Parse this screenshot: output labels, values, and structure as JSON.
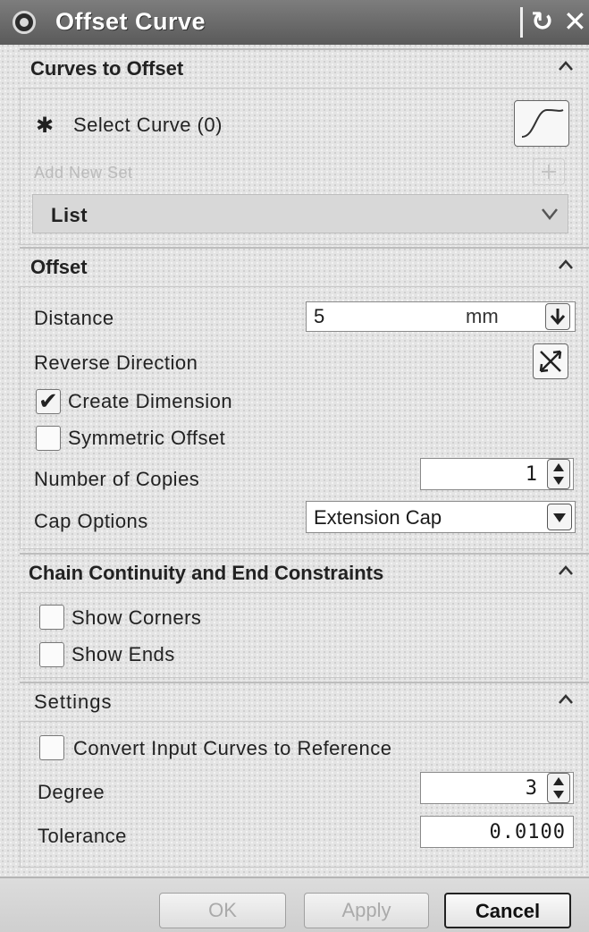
{
  "title_bar": {
    "title": "Offset Curve",
    "gear_icon": "gear-icon",
    "reset_icon": "reset-icon",
    "close_icon": "close-icon",
    "reset_glyph": "↻",
    "close_glyph": "✕"
  },
  "curves_to_offset": {
    "header": "Curves to Offset",
    "select_label": "Select Curve (0)",
    "select_icon": "asterisk-icon",
    "select_glyph": "✱",
    "curve_button_icon": "curve-icon",
    "add_new_set": "Add New Set",
    "add_icon": "add-set-icon",
    "list_label": "List",
    "list_expand_icon": "chevron-down-icon"
  },
  "offset": {
    "header": "Offset",
    "distance_label": "Distance",
    "distance_value": "5",
    "distance_unit": "mm",
    "reverse_label": "Reverse Direction",
    "reverse_icon": "reverse-direction-icon",
    "create_dimension_label": "Create Dimension",
    "create_dimension_checked": true,
    "symmetric_label": "Symmetric Offset",
    "symmetric_checked": false,
    "copies_label": "Number of Copies",
    "copies_value": "1",
    "cap_label": "Cap Options",
    "cap_value": "Extension Cap"
  },
  "chain": {
    "header": "Chain Continuity and End Constraints",
    "show_corners_label": "Show Corners",
    "show_corners_checked": false,
    "show_ends_label": "Show Ends",
    "show_ends_checked": false
  },
  "settings": {
    "header": "Settings",
    "convert_label": "Convert Input Curves to Reference",
    "convert_checked": false,
    "degree_label": "Degree",
    "degree_value": "3",
    "tolerance_label": "Tolerance",
    "tolerance_value": "0.0100"
  },
  "footer": {
    "ok_label": "OK",
    "apply_label": "Apply",
    "cancel_label": "Cancel"
  },
  "colors": {
    "title_bar": "#6b6b6b",
    "panel": "#e4e4e4",
    "disabled_text": "#aaaaaa"
  }
}
